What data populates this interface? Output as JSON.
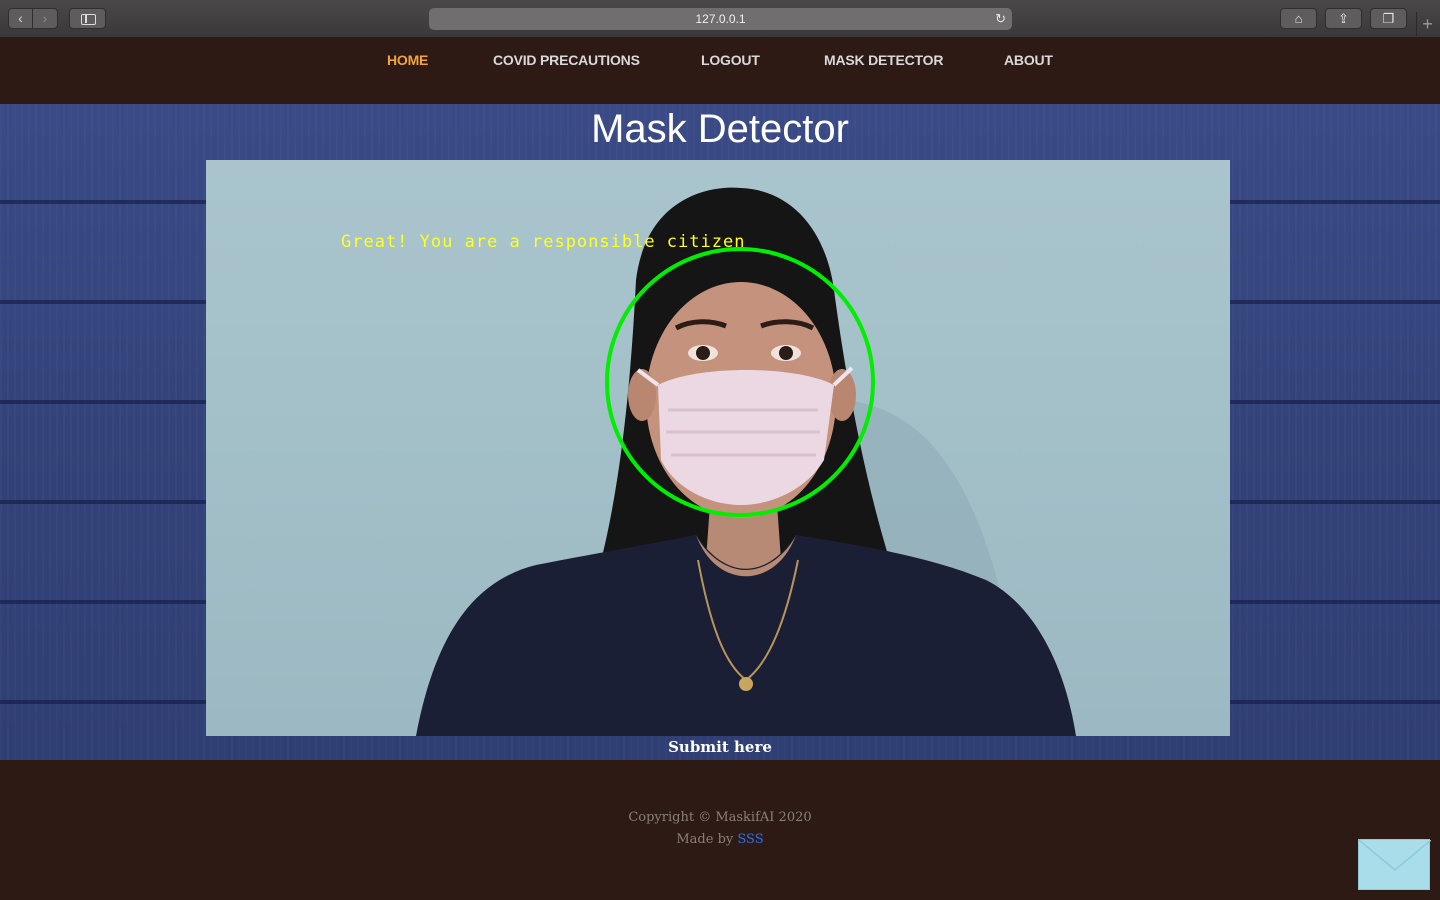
{
  "browser": {
    "url": "127.0.0.1"
  },
  "nav": {
    "items": [
      {
        "label": "HOME",
        "active": true
      },
      {
        "label": "COVID PRECAUTIONS",
        "active": false
      },
      {
        "label": "LOGOUT",
        "active": false
      },
      {
        "label": "MASK DETECTOR",
        "active": false
      },
      {
        "label": "ABOUT",
        "active": false
      }
    ]
  },
  "main": {
    "title": "Mask Detector",
    "detection_message": "Great! You are a responsible citizen",
    "submit_label": "Submit here"
  },
  "footer": {
    "copyright": "Copyright © MaskifAI 2020",
    "made_by_prefix": "Made by ",
    "made_by_link": "SSS"
  },
  "colors": {
    "header_bg": "#2e1a15",
    "active_nav": "#f0a63a",
    "detection_ring": "#00ee00",
    "detection_text": "#ffff22",
    "link": "#2f6fe0"
  }
}
